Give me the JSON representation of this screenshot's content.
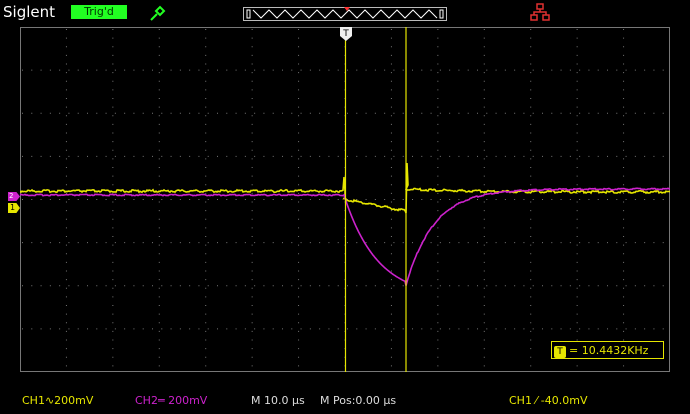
{
  "app": {
    "brand": "Siglent",
    "trigger_status": "Trig'd"
  },
  "measurement": {
    "frequency_icon": "T",
    "frequency": "= 10.4432KHz"
  },
  "status": {
    "ch1": "CH1∿200mV",
    "ch2": "CH2═ 200mV",
    "timebase": "M 10.0 µs",
    "mpos": "M Pos:0.00 µs",
    "trigger": "CH1 ⁄ -40.0mV"
  },
  "markers": {
    "trigger_pos": "T",
    "ch1_level": "1",
    "ch2_level": "2"
  },
  "colors": {
    "ch1": "#e6e600",
    "ch2": "#cc22cc",
    "trig_bg": "#22ff22",
    "grid": "#555555"
  },
  "icons": [
    "probe-icon",
    "network-icon",
    "memory-depth-bar"
  ]
}
